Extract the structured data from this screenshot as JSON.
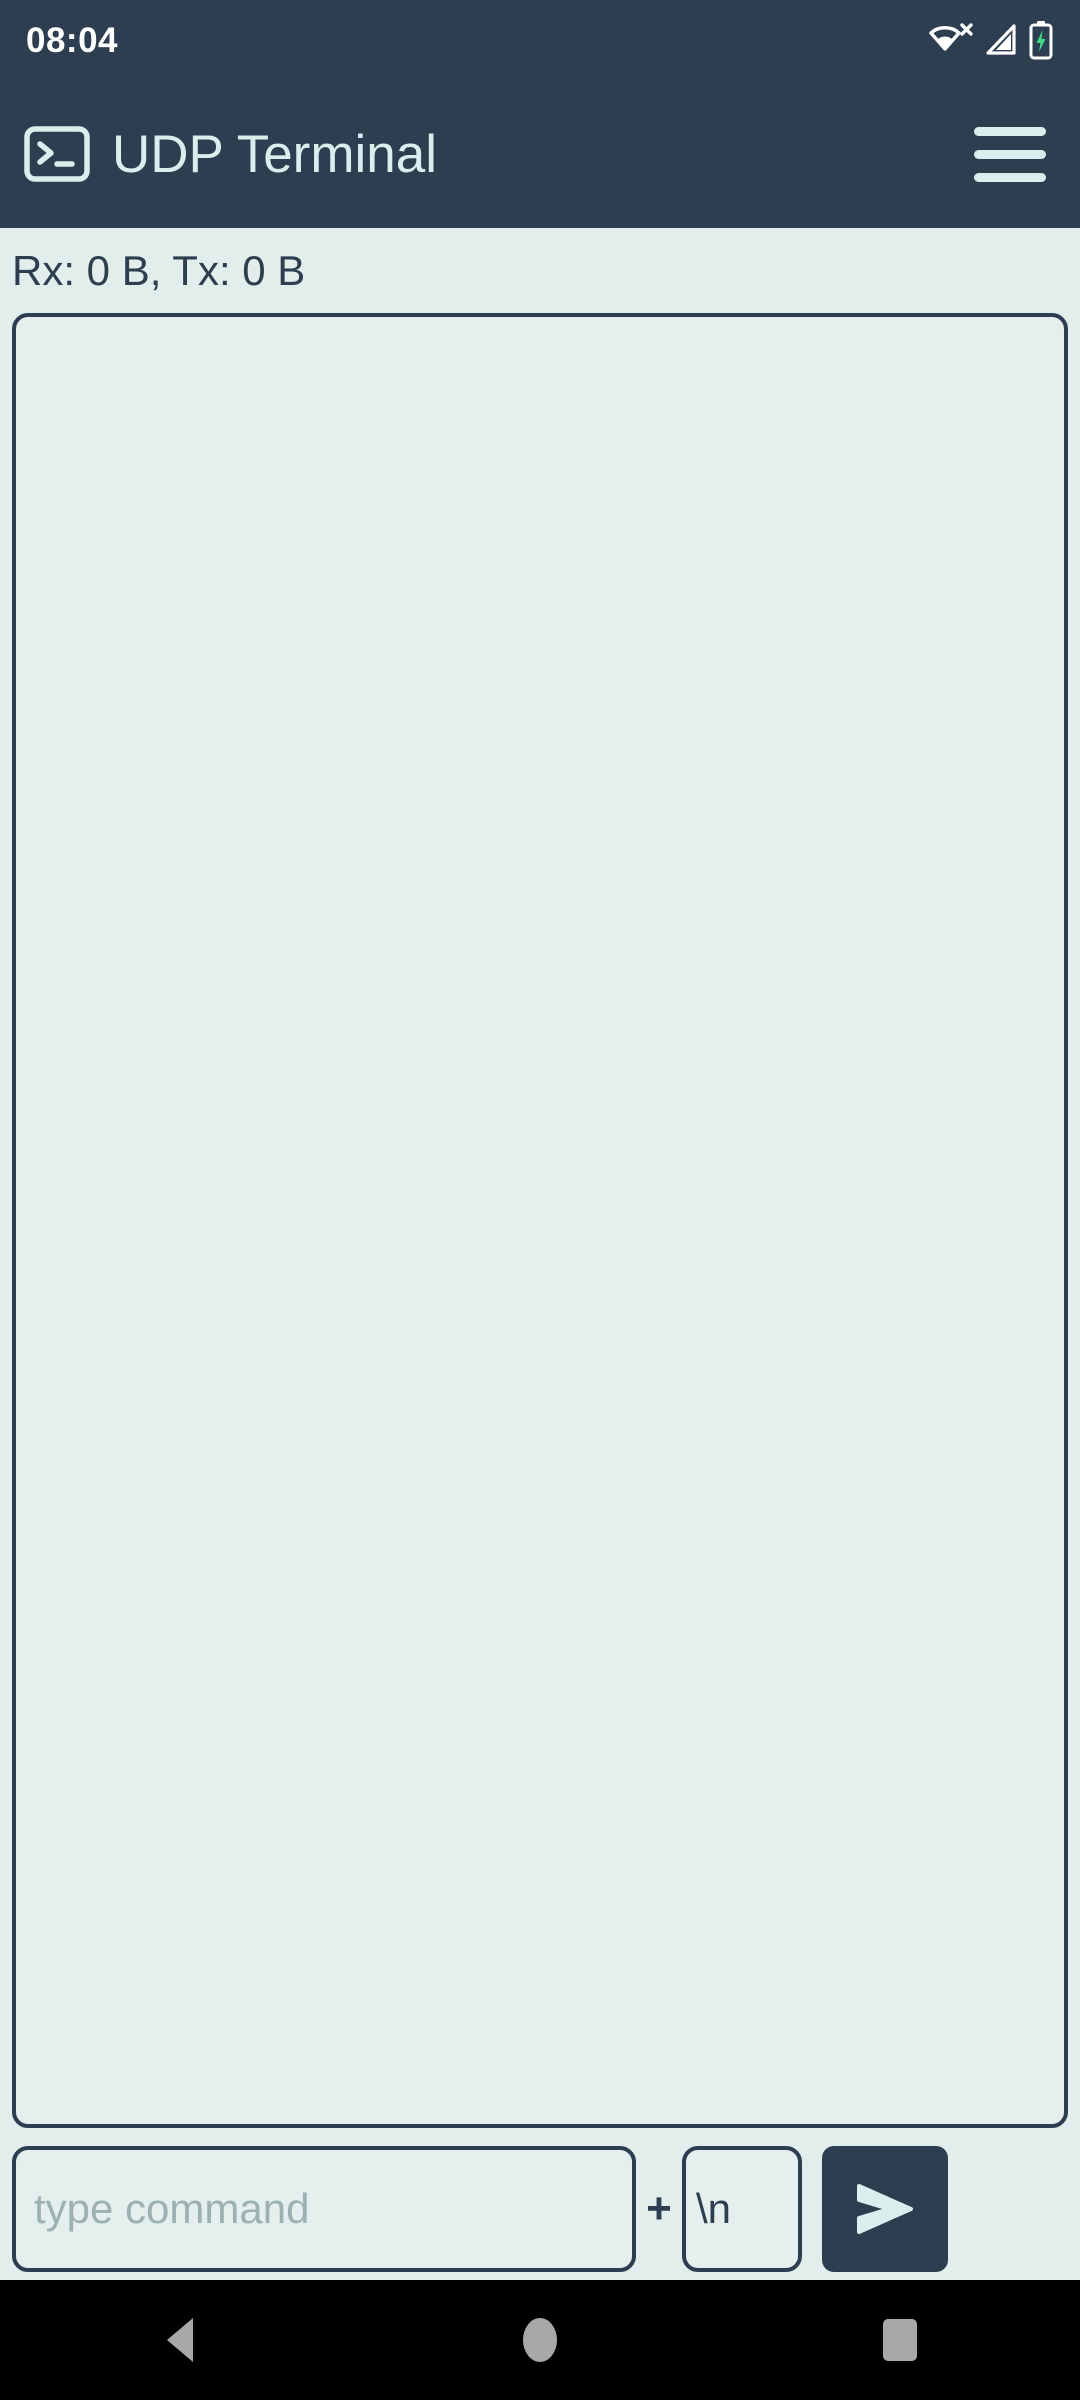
{
  "status_bar": {
    "clock": "08:04",
    "icons": [
      {
        "name": "wifi-no-internet-icon",
        "label": "Wi-Fi disconnected"
      },
      {
        "name": "cell-signal-icon",
        "label": "Mobile signal"
      },
      {
        "name": "battery-charging-icon",
        "label": "Battery charging"
      }
    ],
    "background": "#2c3e50",
    "text_color": "#ffffff",
    "battery_bolt_color": "#3ddc84"
  },
  "app_bar": {
    "icon_name": "terminal-icon",
    "title": "UDP Terminal",
    "menu_label": "Menu",
    "background": "#2c3e50",
    "text_color": "#dbeeed"
  },
  "main": {
    "stats_text": "Rx: 0 B, Tx: 0 B",
    "terminal_output": "",
    "background": "#e1eeec",
    "border_color": "#2c3e50"
  },
  "input_row": {
    "command_placeholder": "type command",
    "command_value": "",
    "plus_label": "+",
    "terminator_value": "\\n",
    "terminator_placeholder": "",
    "send_label": "Send",
    "send_icon_name": "send-arrow-icon",
    "send_background": "#2c3e50"
  },
  "nav_bar": {
    "back_label": "Back",
    "home_label": "Home",
    "recents_label": "Recent apps",
    "background": "#000000",
    "icon_color": "#a8a8a8"
  }
}
